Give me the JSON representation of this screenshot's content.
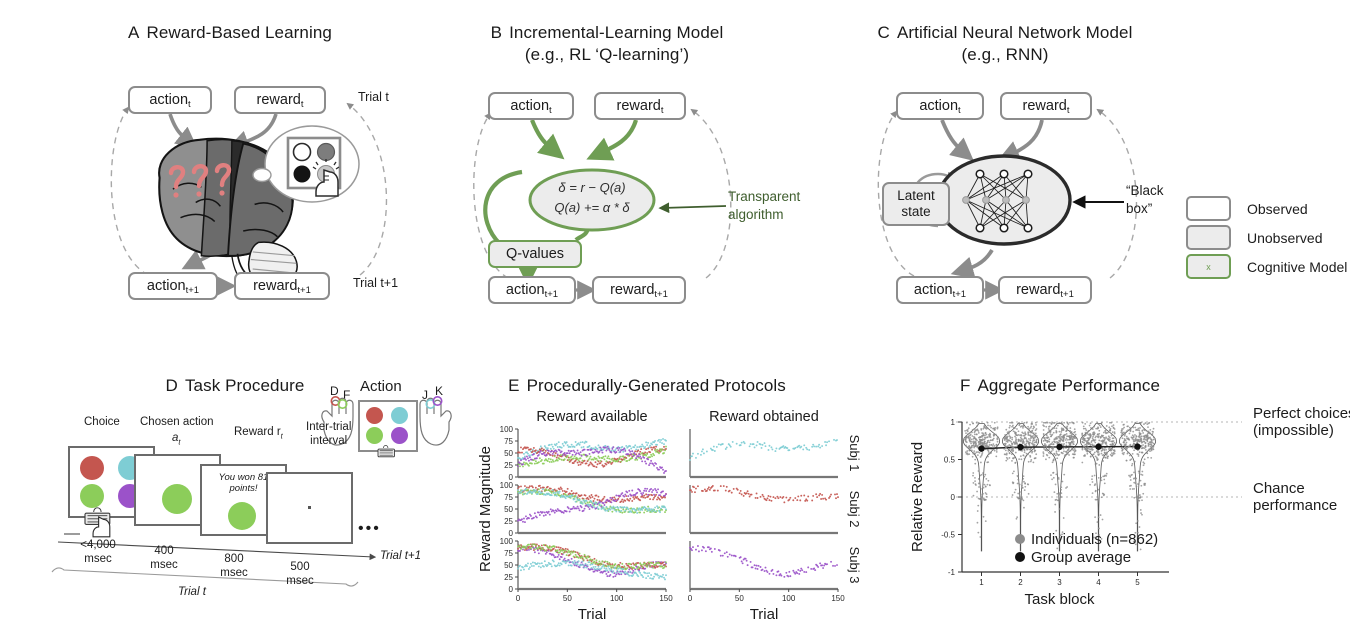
{
  "figure": {
    "panels": [
      {
        "letter": "A",
        "title": "Reward-Based Learning"
      },
      {
        "letter": "B",
        "title": "Incremental-Learning Model",
        "subtitle": "(e.g., RL ‘Q-learning’)"
      },
      {
        "letter": "C",
        "title": "Artificial Neural Network Model",
        "subtitle": "(e.g., RNN)"
      },
      {
        "letter": "D",
        "title": "Task Procedure"
      },
      {
        "letter": "E",
        "title": "Procedurally-Generated Protocols"
      },
      {
        "letter": "F",
        "title": "Aggregate Performance"
      }
    ]
  },
  "panelA": {
    "nodes": {
      "action_t": "action",
      "reward_t": "reward",
      "action_t1": "action",
      "reward_t1": "reward"
    },
    "subs": {
      "t": "t",
      "t1": "t+1"
    },
    "trial_t": "Trial t",
    "trial_t1": "Trial t+1",
    "brain_marks": "???"
  },
  "panelB": {
    "nodes": {
      "action_t": "action",
      "reward_t": "reward",
      "action_t1": "action",
      "reward_t1": "reward"
    },
    "subs": {
      "t": "t",
      "t1": "t+1"
    },
    "equation_line1": "δ = r − Q(a)",
    "equation_line2": "Q(a) += α * δ",
    "qvalues_label": "Q-values",
    "annotation_line1": "Transparent",
    "annotation_line2": "algorithm",
    "accent_color": "#6f9e54"
  },
  "panelC": {
    "nodes": {
      "action_t": "action",
      "reward_t": "reward",
      "action_t1": "action",
      "reward_t1": "reward"
    },
    "subs": {
      "t": "t",
      "t1": "t+1"
    },
    "latent_line1": "Latent",
    "latent_line2": "state",
    "annotation_line1": "“Black",
    "annotation_line2": "box”",
    "legend": [
      {
        "label": "Observed",
        "swatch": "white",
        "mark": ""
      },
      {
        "label": "Unobserved",
        "swatch": "grey",
        "mark": ""
      },
      {
        "label": "Cognitive Model",
        "swatch": "green",
        "mark": "x"
      }
    ]
  },
  "panelD": {
    "screens": [
      {
        "caption": "Choice",
        "duration": "<4,000",
        "unit": "msec",
        "content": "four-circles"
      },
      {
        "caption": "Chosen action",
        "caption_sub": "a",
        "caption_sub_idx": "t",
        "duration": "400",
        "unit": "msec",
        "content": "one-circle"
      },
      {
        "caption": "Reward r",
        "caption_sub_idx": "t",
        "duration": "800",
        "unit": "msec",
        "content": "feedback",
        "feedback_line1": "You won 81",
        "feedback_line2": "points!"
      },
      {
        "caption": "Inter-trial",
        "caption2": "interval",
        "duration": "500",
        "unit": "msec",
        "content": "fixation"
      }
    ],
    "ellipsis": "•••",
    "trial_next": "Trial t+1",
    "trial_brace": "Trial t",
    "action_panel_title": "Action",
    "keys_left": [
      "D",
      "F"
    ],
    "keys_right": [
      "J",
      "K"
    ],
    "colors": {
      "red": "#c4564f",
      "cyan": "#7ecdd4",
      "green": "#8ccd5a",
      "purple": "#9b52c9"
    }
  },
  "chart_data": [
    {
      "id": "panelE",
      "type": "scatter",
      "title": "Procedurally-Generated Protocols",
      "column_titles": [
        "Reward available",
        "Reward obtained"
      ],
      "row_titles": [
        "Subj 1",
        "Subj 2",
        "Subj 3"
      ],
      "xlabel": "Trial",
      "ylabel": "Reward Magnitude",
      "xlim": [
        0,
        150
      ],
      "ylim": [
        0,
        100
      ],
      "xticks": [
        0,
        50,
        100,
        150
      ],
      "yticks": [
        0,
        25,
        50,
        75,
        100
      ],
      "series_colors": {
        "arm1": "#c4564f",
        "arm2": "#7ecdd4",
        "arm3": "#8ccd5a",
        "arm4": "#9b52c9"
      },
      "n_points_per_series": 150,
      "description": "Four bandit arms per subject; left column shows latent reward available for all four arms, right column shows only the reward obtained on the chosen arm.",
      "subjects": [
        {
          "name": "Subj 1",
          "arms": [
            {
              "color": "#7ecdd4",
              "trend": "rising-flat",
              "start": 40,
              "end": 62,
              "mid": 70
            },
            {
              "color": "#c4564f",
              "trend": "falling-rising",
              "start": 55,
              "end": 62,
              "mid": 42
            },
            {
              "color": "#8ccd5a",
              "trend": "rising",
              "start": 20,
              "end": 55,
              "mid": 38
            },
            {
              "color": "#9b52c9",
              "trend": "rising-falling",
              "start": 28,
              "end": 18,
              "mid": 45
            }
          ],
          "chosen_color": "#7ecdd4"
        },
        {
          "name": "Subj 2",
          "arms": [
            {
              "color": "#c4564f",
              "trend": "slow-fall",
              "start": 90,
              "end": 70,
              "mid": 75
            },
            {
              "color": "#8ccd5a",
              "trend": "fall",
              "start": 88,
              "end": 50,
              "mid": 72
            },
            {
              "color": "#9b52c9",
              "trend": "rise",
              "start": 22,
              "end": 78,
              "mid": 58
            },
            {
              "color": "#7ecdd4",
              "trend": "fall",
              "start": 25,
              "end": 18,
              "mid": 14
            }
          ],
          "chosen_color": "#c4564f"
        },
        {
          "name": "Subj 3",
          "arms": [
            {
              "color": "#9b52c9",
              "trend": "fall-rise",
              "start": 85,
              "end": 60,
              "mid": 45
            },
            {
              "color": "#c4564f",
              "trend": "fall",
              "start": 82,
              "end": 35,
              "mid": 62
            },
            {
              "color": "#8ccd5a",
              "trend": "fall",
              "start": 78,
              "end": 40,
              "mid": 58
            },
            {
              "color": "#7ecdd4",
              "trend": "flat-fall",
              "start": 42,
              "end": 30,
              "mid": 48
            }
          ],
          "chosen_color": "#9b52c9"
        }
      ]
    },
    {
      "id": "panelF",
      "type": "violin",
      "title": "Aggregate Performance",
      "xlabel": "Task block",
      "ylabel": "Relative Reward",
      "xticks": [
        1,
        2,
        3,
        4,
        5
      ],
      "yticks": [
        1,
        0.5,
        0,
        -0.5,
        -1
      ],
      "ylim": [
        -1,
        1
      ],
      "reference_lines": [
        {
          "value": 1,
          "label_line1": "Perfect choices",
          "label_line2": "(impossible)"
        },
        {
          "value": 0,
          "label_line1": "Chance",
          "label_line2": "performance"
        }
      ],
      "legend": [
        {
          "label": "Individuals (n=862)",
          "color": "#8c8c8c"
        },
        {
          "label": "Group average",
          "color": "#111111"
        }
      ],
      "group_average": [
        0.645,
        0.665,
        0.668,
        0.67,
        0.672
      ],
      "n": 862,
      "violin_spread": {
        "upper": 0.98,
        "lower": -0.72,
        "mode": 0.75
      }
    }
  ]
}
